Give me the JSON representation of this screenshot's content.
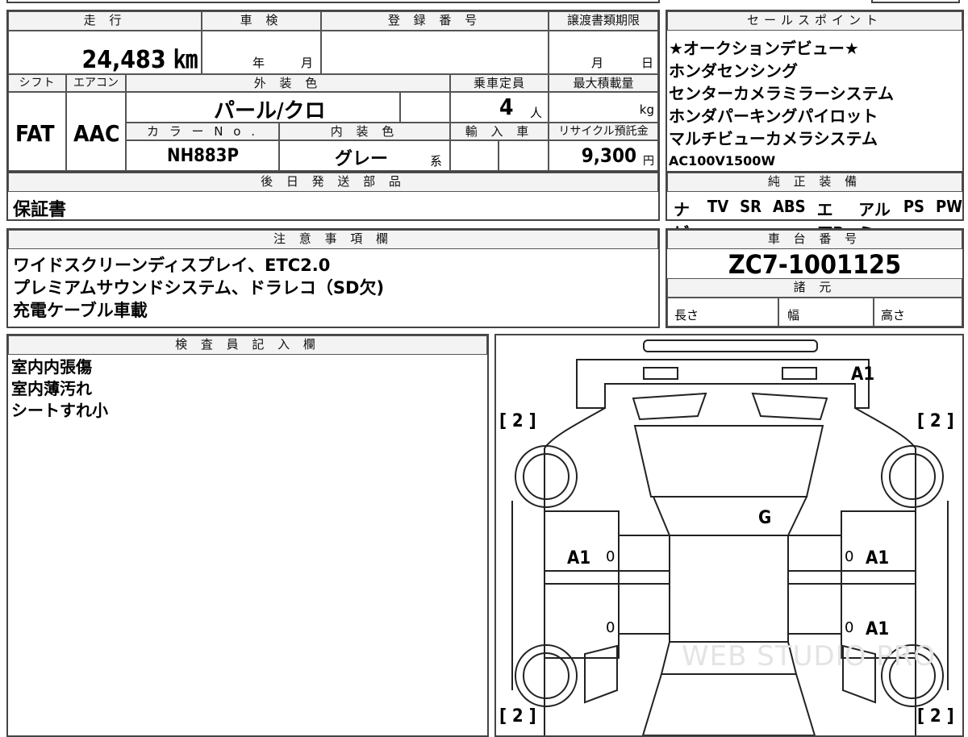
{
  "labels": {
    "mileage": "走 行",
    "inspection": "車 検",
    "registration": "登 録 番 号",
    "transfer_deadline": "譲渡書類期限",
    "selling_points": "セールスポイント",
    "shift": "シフト",
    "aircon": "エアコン",
    "exterior_color": "外 装 色",
    "capacity": "乗車定員",
    "max_load": "最大積載量",
    "color_no": "カ ラ ー N o .",
    "interior_color": "内 装 色",
    "import_car": "輸 入 車",
    "recycle_fee": "リサイクル預託金",
    "parts_later": "後 日 発 送 部 品",
    "equipment": "純 正 装 備",
    "notes": "注 意 事 項 欄",
    "chassis_no": "車 台 番 号",
    "specs": "諸 元",
    "length": "長さ",
    "width": "幅",
    "height": "高さ",
    "inspector": "検 査 員 記 入 欄"
  },
  "values": {
    "mileage": "24,483 ㎞",
    "year_unit": "年",
    "month_unit": "月",
    "month2": "月",
    "day": "日",
    "shift": "FAT",
    "aircon": "AAC",
    "exterior_color": "パール/クロ",
    "capacity": "4",
    "capacity_unit": "人",
    "load_unit": "kg",
    "color_no": "NH883P",
    "interior_color": "グレー",
    "interior_suffix": "系",
    "recycle_fee": "9,300",
    "yen": "円",
    "parts_later": "保証書",
    "chassis_no": "ZC7-1001125"
  },
  "selling_points": [
    "★オークションデビュー★",
    "ホンダセンシング",
    "センターカメラミラーシステム",
    "ホンダパーキングパイロット",
    "マルチビューカメラシステム",
    "AC100V1500W"
  ],
  "equipment": [
    "ナビ",
    "TV",
    "SR",
    "ABS",
    "エアB",
    "アルミ",
    "PS",
    "PW"
  ],
  "notes": [
    "ワイドスクリーンディスプレイ、ETC2.0",
    "プレミアムサウンドシステム、ドラレコ（SD欠)",
    "充電ケーブル車載"
  ],
  "inspector_notes": [
    "室内内張傷",
    "室内薄汚れ",
    "シートすれ小"
  ],
  "diagram": {
    "top_right": "A1",
    "center": "G",
    "left_front": "A1",
    "right_front": "A1",
    "right_rear": "A1",
    "zero_marks": [
      "0",
      "0",
      "0",
      "0"
    ],
    "tire_tl": "[ 2 ]",
    "tire_tr": "[ 2 ]",
    "tire_bl": "[ 2 ]",
    "tire_br": "[ 2 ]",
    "watermark": "WEB STUDIO PRO"
  }
}
